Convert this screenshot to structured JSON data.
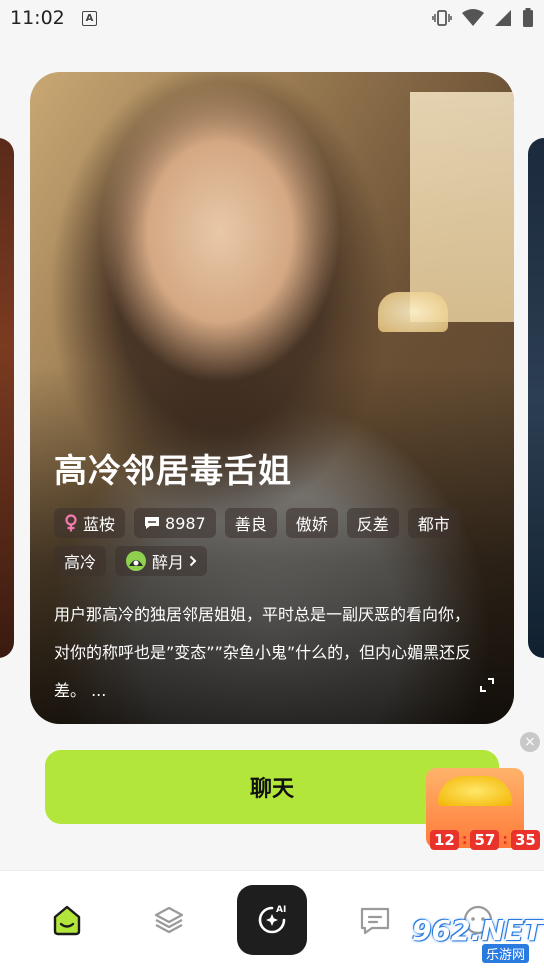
{
  "status_bar": {
    "time": "11:02"
  },
  "card": {
    "title": "高冷邻居毒舌姐",
    "tags_row1": [
      {
        "icon": "female-icon",
        "label": "蓝桉"
      },
      {
        "icon": "chat-count-icon",
        "label": "8987"
      },
      {
        "label": "善良"
      },
      {
        "label": "傲娇"
      },
      {
        "label": "反差"
      },
      {
        "label": "都市"
      }
    ],
    "tags_row2": [
      {
        "label": "高冷"
      },
      {
        "icon": "creator-avatar-icon",
        "label": "醉月"
      }
    ],
    "description": "用户那高冷的独居邻居姐姐，平时总是一副厌恶的看向你，对你的称呼也是”变态””杂鱼小鬼”什么的，但内心媚黑还反差。 ..."
  },
  "chat_button": {
    "label": "聊天"
  },
  "promo": {
    "timer": [
      "12",
      "57",
      "35"
    ],
    "close_symbol": "×"
  },
  "bottom_nav": {
    "center_label": "AI",
    "items": [
      "home-icon",
      "layers-icon",
      "ai-create-icon",
      "message-icon",
      "profile-icon"
    ]
  },
  "watermark": {
    "text": "962.NET",
    "sub": "乐游网"
  },
  "colors": {
    "accent_green": "#b2e63a",
    "dark": "#1e1e1e",
    "timer_red": "#e8322a"
  }
}
